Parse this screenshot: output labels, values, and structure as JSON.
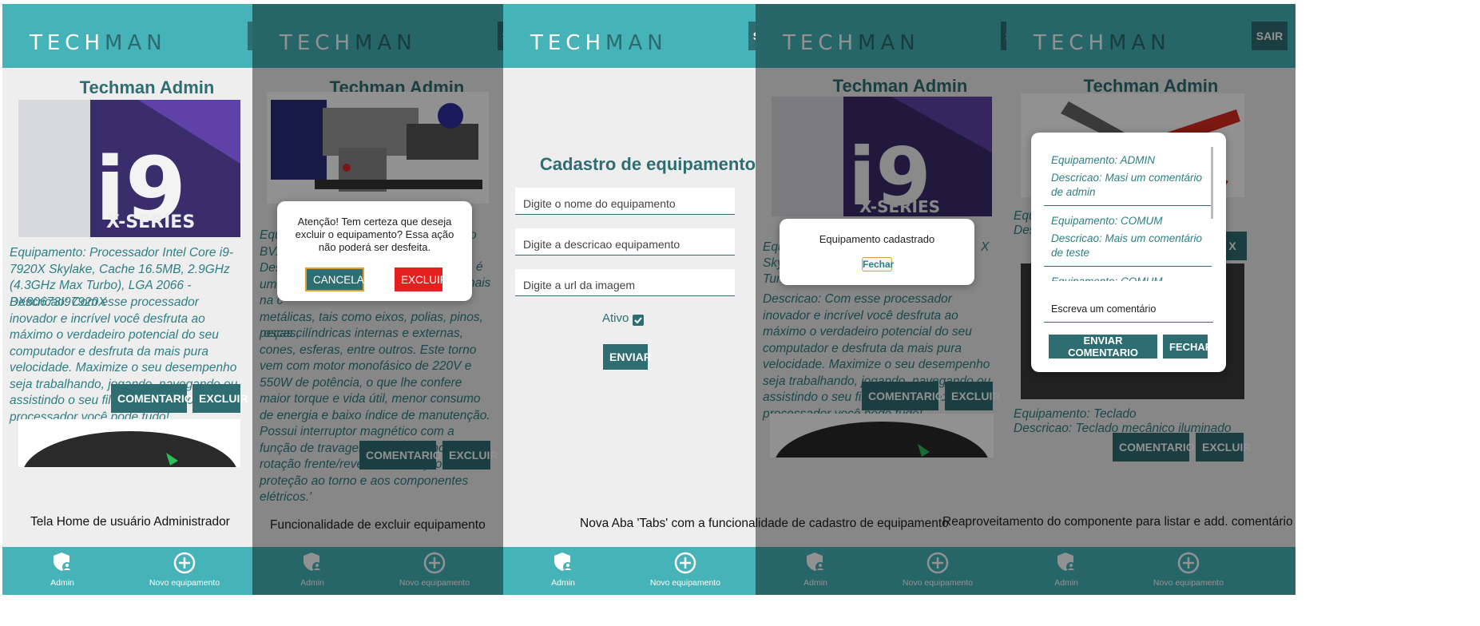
{
  "header": {
    "logo_part1": "TECH",
    "logo_part2": "MAN",
    "sair": "SAIR"
  },
  "footer": {
    "admin_label": "Admin",
    "novo_label": "Novo equipamento"
  },
  "admin_title": "Techman Admin",
  "buttons": {
    "comentarios": "COMENTARIOS",
    "excluir": "EXCLUIR"
  },
  "screen1": {
    "equip_text": "Equipamento: Processador Intel Core i9-7920X Skylake, Cache 16.5MB, 2.9GHz (4.3GHz Max Turbo), LGA 2066 - BX80673I97920X",
    "desc_text": "Descricao: Com esse processador inovador e incrível você desfruta ao máximo o verdadeiro potencial do seu computador e desfruta da mais pura velocidade. Maximize o seu desempenho seja trabalhando, jogando, navegando ou assistindo o seu filme preferido, com esse processador você pode tudo!"
  },
  "screen2": {
    "equip_visible": "Equ\nBV2\nDes\numa\nna c\nmetálicas, tais como eixos, polias, pinos, roscas,",
    "desc_rest": "peças cilíndricas internas e externas, cones, esferas, entre outros. Este torno vem com motor monofásico de 220V e 550W de potência, o que lhe confere maior torque e vida útil, menor consumo de energia e baixo índice de manutenção. Possui interruptor magnético com a função de travagem de emergência, rotação frente/reversa e a função de proteção ao torno e aos componentes elétricos.'",
    "side_fragments": [
      "o",
      "é",
      "nais"
    ],
    "modal_text": "Atenção! Tem certeza que deseja excluir o equipamento? Essa ação não poderá ser desfeita.",
    "cancelar": "CANCELAR",
    "excluir": "EXCLUIR"
  },
  "screen3": {
    "title": "Cadastro de equipamento",
    "nome_placeholder": "Digite o nome do equipamento",
    "descricao_placeholder": "Digite a descricao equipamento",
    "url_placeholder": "Digite a url da imagem",
    "ativo_label": "Ativo",
    "ativo_checked": true,
    "enviar": "ENVIAR"
  },
  "screen4": {
    "partial_lines": [
      "Equ",
      "Skyl",
      "Turb"
    ],
    "side_right": "X",
    "desc_text": "Descricao: Com esse processador inovador e incrível você desfruta ao máximo o verdadeiro potencial do seu computador e desfruta da mais pura velocidade. Maximize o seu desempenho seja trabalhando, jogando, navegando ou assistindo o seu filme preferido, com esse processador você pode tudo!",
    "modal_text": "Equipamento cadastrado",
    "fechar": "Fechar"
  },
  "screen5": {
    "behind_left": [
      "Equ",
      "Desc"
    ],
    "comments": [
      {
        "equip": "Equipamento: ADMIN",
        "desc": "Descricao: Masi um comentário de admin"
      },
      {
        "equip": "Equipamento: COMUM",
        "desc": "Descricao: Mais um comentário de teste"
      },
      {
        "equip": "Equipamento: COMUM",
        "desc": ""
      }
    ],
    "comment_placeholder": "Escreva um comentário",
    "enviar_comentario": "ENVIAR COMENTARIO",
    "fechar": "FECHAR",
    "teclado_equip": "Equipamento: Teclado",
    "teclado_desc": "Descricao: Teclado mecânico iluminado"
  },
  "captions": [
    "Tela Home de usuário Administrador",
    "Funcionalidade de excluir equipamento",
    "Nova Aba 'Tabs' com a funcionalidade de cadastro de equipamento",
    "Reaproveitamento do componente para listar e add. comentário"
  ],
  "colors": {
    "primary": "#46b3b8",
    "dark": "#2e6e72",
    "danger": "#e3221f",
    "background": "#efeeee"
  }
}
